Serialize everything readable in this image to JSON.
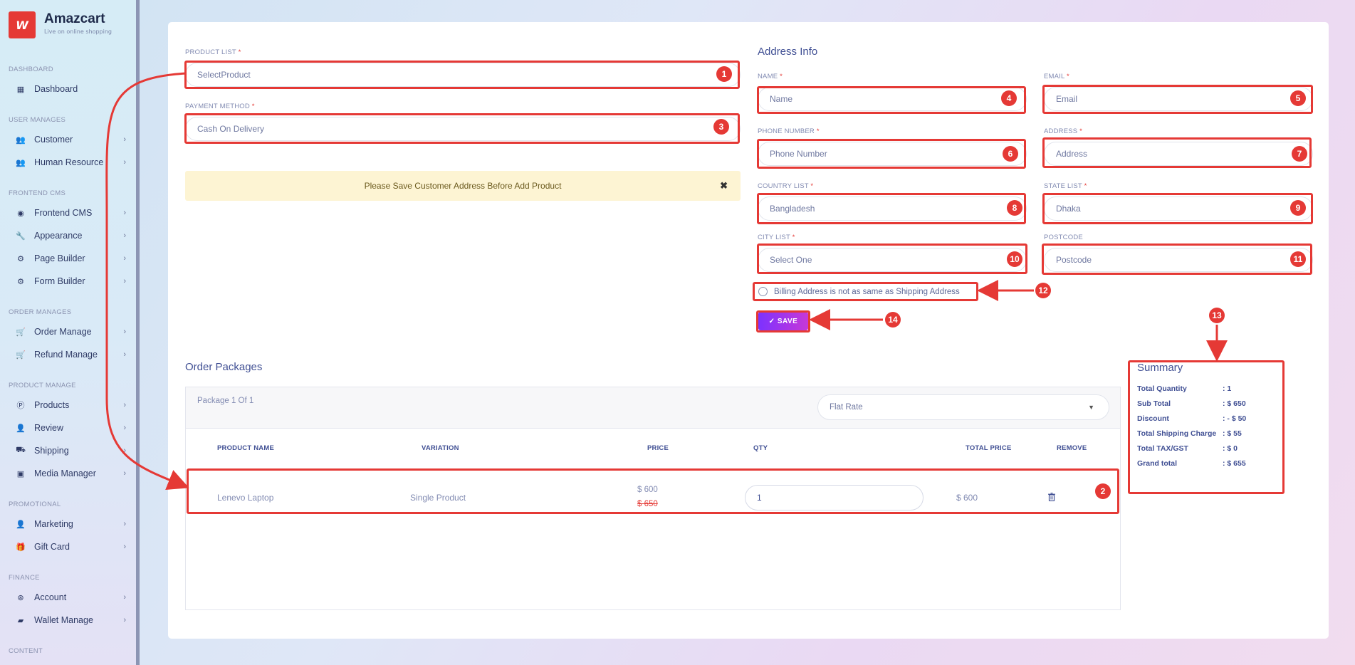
{
  "brand": {
    "name": "Amazcart",
    "tagline": "Live on online shopping"
  },
  "sidebar": {
    "sections": [
      {
        "title": "DASHBOARD",
        "items": [
          {
            "label": "Dashboard",
            "icon": "grid-icon",
            "chevron": false
          }
        ]
      },
      {
        "title": "USER MANAGES",
        "items": [
          {
            "label": "Customer",
            "icon": "users-icon",
            "chevron": true
          },
          {
            "label": "Human Resource",
            "icon": "users-icon",
            "chevron": true
          }
        ]
      },
      {
        "title": "FRONTEND CMS",
        "items": [
          {
            "label": "Frontend CMS",
            "icon": "eye-icon",
            "chevron": true
          },
          {
            "label": "Appearance",
            "icon": "wrench-icon",
            "chevron": true
          },
          {
            "label": "Page Builder",
            "icon": "cogs-icon",
            "chevron": true
          },
          {
            "label": "Form Builder",
            "icon": "cogs-icon",
            "chevron": true
          }
        ]
      },
      {
        "title": "ORDER MANAGES",
        "items": [
          {
            "label": "Order Manage",
            "icon": "cart-icon",
            "chevron": true
          },
          {
            "label": "Refund Manage",
            "icon": "cart-icon",
            "chevron": true
          }
        ]
      },
      {
        "title": "PRODUCT MANAGE",
        "items": [
          {
            "label": "Products",
            "icon": "product-icon",
            "chevron": true
          },
          {
            "label": "Review",
            "icon": "user-icon",
            "chevron": true
          },
          {
            "label": "Shipping",
            "icon": "truck-icon",
            "chevron": true
          },
          {
            "label": "Media Manager",
            "icon": "image-icon",
            "chevron": true
          }
        ]
      },
      {
        "title": "PROMOTIONAL",
        "items": [
          {
            "label": "Marketing",
            "icon": "user-icon",
            "chevron": true
          },
          {
            "label": "Gift Card",
            "icon": "gift-icon",
            "chevron": true
          }
        ]
      },
      {
        "title": "FINANCE",
        "items": [
          {
            "label": "Account",
            "icon": "coin-icon",
            "chevron": true
          },
          {
            "label": "Wallet Manage",
            "icon": "wallet-icon",
            "chevron": true
          }
        ]
      },
      {
        "title": "CONTENT",
        "items": []
      }
    ]
  },
  "form": {
    "product_list_label": "PRODUCT LIST",
    "product_list_value": "SelectProduct",
    "payment_method_label": "PAYMENT METHOD",
    "payment_method_value": "Cash On Delivery",
    "required_mark": "*",
    "alert_text": "Please Save Customer Address Before Add Product",
    "alert_close": "✖"
  },
  "address": {
    "title": "Address Info",
    "name_label": "NAME",
    "name_placeholder": "Name",
    "email_label": "EMAIL",
    "email_placeholder": "Email",
    "phone_label": "PHONE NUMBER",
    "phone_placeholder": "Phone Number",
    "address_label": "ADDRESS",
    "address_placeholder": "Address",
    "country_label": "COUNTRY LIST",
    "country_value": "Bangladesh",
    "state_label": "STATE LIST",
    "state_value": "Dhaka",
    "city_label": "CITY LIST",
    "city_value": "Select One",
    "postcode_label": "POSTCODE",
    "postcode_placeholder": "Postcode",
    "billing_text": "Billing Address is not as same as Shipping Address",
    "save_label": "✓ SAVE"
  },
  "packages": {
    "title": "Order Packages",
    "package_label": "Package 1 Of 1",
    "shipping_method": "Flat Rate",
    "columns": [
      "PRODUCT NAME",
      "VARIATION",
      "PRICE",
      "QTY",
      "TOTAL PRICE",
      "REMOVE"
    ],
    "rows": [
      {
        "product_name": "Lenevo Laptop",
        "variation": "Single Product",
        "price": "$ 600",
        "old_price": "$ 650",
        "qty": "1",
        "total_price": "$ 600"
      }
    ]
  },
  "summary": {
    "title": "Summary",
    "rows": [
      {
        "label": "Total Quantity",
        "value": ": 1"
      },
      {
        "label": "Sub Total",
        "value": ": $ 650"
      },
      {
        "label": "Discount",
        "value": ": - $ 50"
      },
      {
        "label": "Total Shipping Charge",
        "value": ": $ 55"
      },
      {
        "label": "Total TAX/GST",
        "value": ": $ 0"
      },
      {
        "label": "Grand total",
        "value": ": $ 655"
      }
    ]
  },
  "annotations": [
    "1",
    "2",
    "3",
    "4",
    "5",
    "6",
    "7",
    "8",
    "9",
    "10",
    "11",
    "12",
    "13",
    "14"
  ],
  "colors": {
    "annotation": "#e53935",
    "save_gradient_start": "#7c32ff",
    "save_gradient_end": "#c738d8",
    "alert_bg": "#fdf4d3"
  }
}
